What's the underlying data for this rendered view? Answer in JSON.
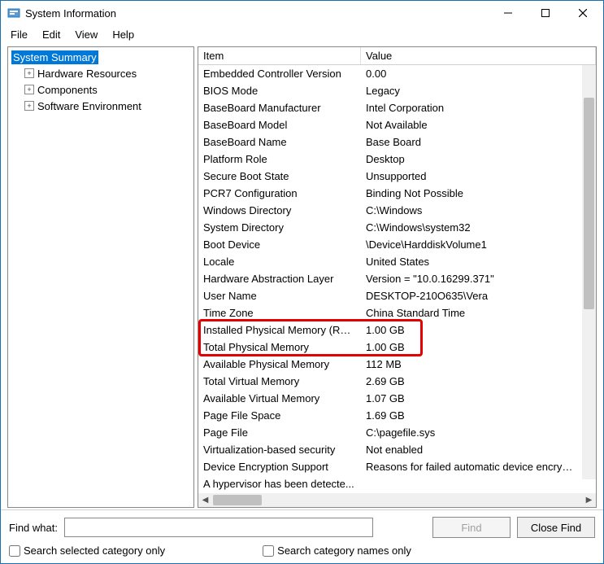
{
  "title": "System Information",
  "menu": {
    "file": "File",
    "edit": "Edit",
    "view": "View",
    "help": "Help"
  },
  "tree": {
    "root": "System Summary",
    "children": [
      {
        "label": "Hardware Resources"
      },
      {
        "label": "Components"
      },
      {
        "label": "Software Environment"
      }
    ]
  },
  "listHeaders": {
    "item": "Item",
    "value": "Value"
  },
  "rows": [
    {
      "item": "Embedded Controller Version",
      "value": "0.00"
    },
    {
      "item": "BIOS Mode",
      "value": "Legacy"
    },
    {
      "item": "BaseBoard Manufacturer",
      "value": "Intel Corporation"
    },
    {
      "item": "BaseBoard Model",
      "value": "Not Available"
    },
    {
      "item": "BaseBoard Name",
      "value": "Base Board"
    },
    {
      "item": "Platform Role",
      "value": "Desktop"
    },
    {
      "item": "Secure Boot State",
      "value": "Unsupported"
    },
    {
      "item": "PCR7 Configuration",
      "value": "Binding Not Possible"
    },
    {
      "item": "Windows Directory",
      "value": "C:\\Windows"
    },
    {
      "item": "System Directory",
      "value": "C:\\Windows\\system32"
    },
    {
      "item": "Boot Device",
      "value": "\\Device\\HarddiskVolume1"
    },
    {
      "item": "Locale",
      "value": "United States"
    },
    {
      "item": "Hardware Abstraction Layer",
      "value": "Version = \"10.0.16299.371\""
    },
    {
      "item": "User Name",
      "value": "DESKTOP-210O635\\Vera"
    },
    {
      "item": "Time Zone",
      "value": "China Standard Time"
    },
    {
      "item": "Installed Physical Memory (RAM)",
      "value": "1.00 GB",
      "hl": true
    },
    {
      "item": "Total Physical Memory",
      "value": "1.00 GB",
      "hl": true
    },
    {
      "item": "Available Physical Memory",
      "value": "112 MB"
    },
    {
      "item": "Total Virtual Memory",
      "value": "2.69 GB"
    },
    {
      "item": "Available Virtual Memory",
      "value": "1.07 GB"
    },
    {
      "item": "Page File Space",
      "value": "1.69 GB"
    },
    {
      "item": "Page File",
      "value": "C:\\pagefile.sys"
    },
    {
      "item": "Virtualization-based security",
      "value": "Not enabled"
    },
    {
      "item": "Device Encryption Support",
      "value": "Reasons for failed automatic device encryption"
    },
    {
      "item": "A hypervisor has been detecte...",
      "value": ""
    }
  ],
  "find": {
    "label": "Find what:",
    "button": "Find",
    "close": "Close Find",
    "cb1": "Search selected category only",
    "cb2": "Search category names only"
  }
}
